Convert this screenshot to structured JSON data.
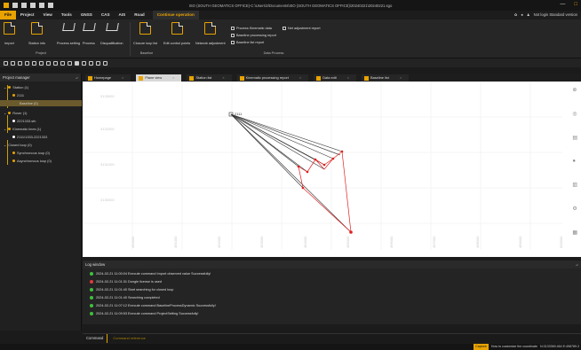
{
  "window": {
    "title": "ISO (SOUTH GEOMATICS OFFICE)-C:\\Users\\z\\Documents\\ISO (SOUTH GEOMATICS OFFICE)\\20240221\\20240221.sgo",
    "minimize": "—",
    "maximize": "□"
  },
  "menu": {
    "items": [
      "File",
      "Project",
      "View",
      "Tools",
      "GNSS",
      "CAS",
      "AIS",
      "Road",
      "Continue operation"
    ],
    "right_text": "Not login Standard version"
  },
  "ribbon": {
    "buttons": [
      "Import",
      "Station info",
      "Process setting",
      "Process",
      "Disqualification",
      "Closure loop list",
      "Edit control points",
      "Network adjustment"
    ],
    "small": [
      "Process Kinematic data",
      "Net adjustment report",
      "Baseline processing report",
      "Baseline list report"
    ],
    "groups": [
      "Project",
      "Baseline",
      "Data Process"
    ]
  },
  "project_manager": {
    "title": "Project manager",
    "tree": [
      {
        "label": "Station (1)",
        "color": "#e8a300"
      },
      {
        "label": "2111",
        "color": "#e8a300"
      },
      {
        "label": "Baseline (0)",
        "color": "#e8a300",
        "selected": true
      },
      {
        "label": "Rover (1)",
        "color": "#e8a300"
      },
      {
        "label": "2221333.sth",
        "color": "#ffffff"
      },
      {
        "label": "Kinematic lines (1)",
        "color": "#e8a300"
      },
      {
        "label": "2111\\1333-2221333",
        "color": "#ffffff"
      },
      {
        "label": "Closed loop (0)",
        "color": "#e8a300"
      },
      {
        "label": "Synchronous loop (0)",
        "color": "#e8a300"
      },
      {
        "label": "Asynchronous loop (0)",
        "color": "#e8a300"
      }
    ]
  },
  "tabs": [
    "Homepage",
    "Plane view",
    "Station list",
    "Kinematic processing report",
    "Data edit",
    "Baseline list"
  ],
  "active_tab": "Plane view",
  "canvas": {
    "station_label": "2111",
    "y_ticks": [
      "3133000",
      "3132000",
      "3131000",
      "3130000"
    ],
    "x_ticks": [
      "490000",
      "491000",
      "492000",
      "493000",
      "494000",
      "495000",
      "496000",
      "497000",
      "498000",
      "499000",
      "500000"
    ]
  },
  "log": {
    "title": "Log window",
    "lines": [
      {
        "text": "2024-02-21 11:00:04 Execute command Import observed value Successfully!",
        "color": "#3ec13e"
      },
      {
        "text": "2024-02-21 11:01:31 Dongle license is used",
        "color": "#e03a3a"
      },
      {
        "text": "2024-02-21 11:01:40 Start searching for closed loop",
        "color": "#3ec13e"
      },
      {
        "text": "2024-02-21 11:01:40 Searching completed",
        "color": "#3ec13e"
      },
      {
        "text": "2024-02-21 11:07:12 Execute command BaselineProcessDynamic Successfully!",
        "color": "#3ec13e"
      },
      {
        "text": "2024-02-21 11:09:53 Execute command ProjectSetting Successfully!",
        "color": "#3ec13e"
      }
    ]
  },
  "command": {
    "label": "Command",
    "placeholder": "Command reference"
  },
  "status": {
    "caps": "Capture",
    "help": "How to customize the coordinate",
    "coords": "N:3133369.464   E:498789.3"
  },
  "colors": {
    "accent": "#e8a300",
    "baseline_red": "#e02020"
  }
}
